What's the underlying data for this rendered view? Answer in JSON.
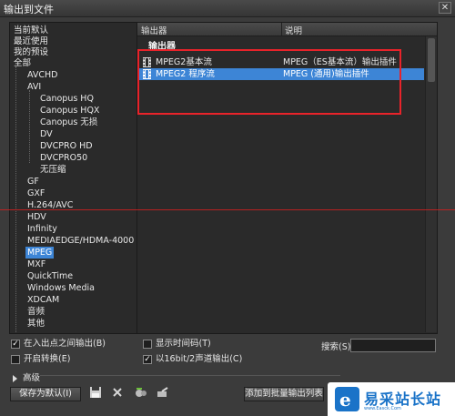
{
  "window": {
    "title": "输出到文件"
  },
  "tree": {
    "items": [
      {
        "label": "当前默认"
      },
      {
        "label": "最近使用"
      },
      {
        "label": "我的预设"
      },
      {
        "label": "全部"
      },
      {
        "label": "AVCHD"
      },
      {
        "label": "AVI"
      },
      {
        "label": "Canopus HQ"
      },
      {
        "label": "Canopus HQX"
      },
      {
        "label": "Canopus 无损"
      },
      {
        "label": "DV"
      },
      {
        "label": "DVCPRO HD"
      },
      {
        "label": "DVCPRO50"
      },
      {
        "label": "无压缩"
      },
      {
        "label": "GF"
      },
      {
        "label": "GXF"
      },
      {
        "label": "H.264/AVC"
      },
      {
        "label": "HDV"
      },
      {
        "label": "Infinity"
      },
      {
        "label": "MEDIAEDGE/HDMA-4000"
      },
      {
        "label": "MPEG"
      },
      {
        "label": "MXF"
      },
      {
        "label": "QuickTime"
      },
      {
        "label": "Windows Media"
      },
      {
        "label": "XDCAM"
      },
      {
        "label": "音频"
      },
      {
        "label": "其他"
      }
    ],
    "selected": "MPEG"
  },
  "list": {
    "columns": [
      "输出器",
      "说明"
    ],
    "group": "输出器",
    "rows": [
      {
        "name": "MPEG2基本流",
        "desc": "MPEG（ES基本流）输出插件",
        "selected": false
      },
      {
        "name": "MPEG2 程序流",
        "desc": "MPEG (通用)输出插件",
        "selected": true
      }
    ]
  },
  "options": {
    "in_out": {
      "label": "在入出点之间输出(B)",
      "checked": true
    },
    "show_timecode": {
      "label": "显示时间码(T)",
      "checked": false
    },
    "open_convert": {
      "label": "开启转换(E)",
      "checked": false
    },
    "bit16": {
      "label": "以16bit/2声道输出(C)",
      "checked": true
    }
  },
  "search": {
    "label": "搜索(S)",
    "value": ""
  },
  "advanced": {
    "label": "高级"
  },
  "buttons": {
    "save_default": "保存为默认(I)",
    "add_batch": "添加到批量输出列表"
  },
  "watermark": {
    "mark": "e",
    "text": "易采站长站",
    "sub": "www.Easck.Com"
  },
  "colors": {
    "selection": "#3d85d6",
    "highlight_box": "#e8232a"
  }
}
